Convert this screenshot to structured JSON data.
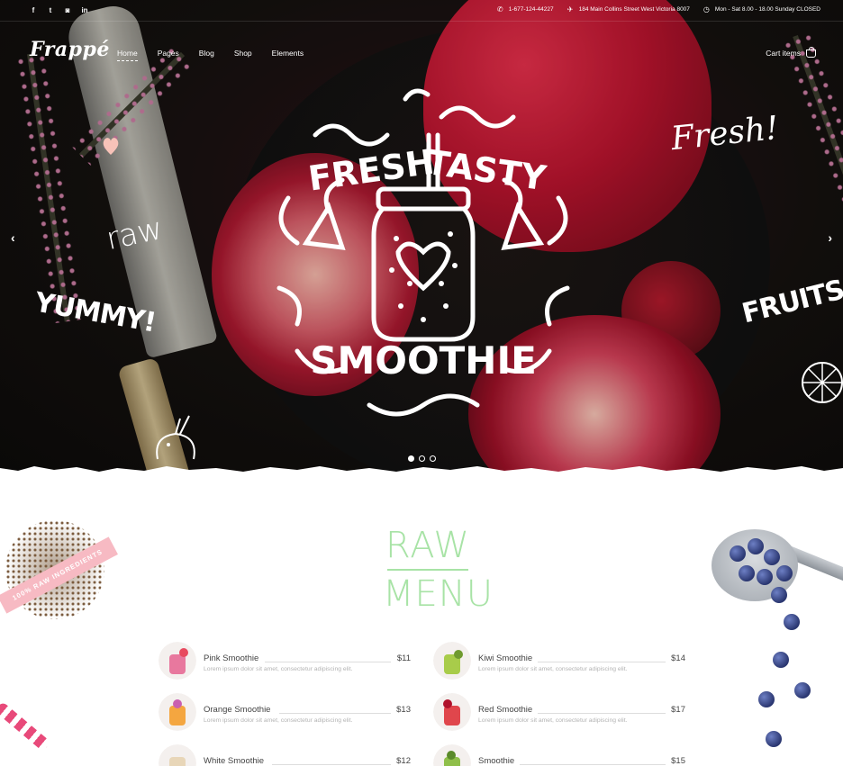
{
  "social": {
    "items": [
      {
        "icon": "facebook-icon",
        "glyph": "f"
      },
      {
        "icon": "twitter-icon",
        "glyph": "t"
      },
      {
        "icon": "instagram-icon",
        "glyph": "◙"
      },
      {
        "icon": "linkedin-icon",
        "glyph": "in"
      }
    ]
  },
  "contact": {
    "phone": "1-677-124-44227",
    "address": "184 Main Collins Street West Victoria 8007",
    "hours": "Mon - Sat 8.00 - 18.00 Sunday CLOSED"
  },
  "brand": {
    "logo": "Frappé"
  },
  "nav": {
    "items": [
      {
        "label": "Home",
        "active": true
      },
      {
        "label": "Pages",
        "active": false
      },
      {
        "label": "Blog",
        "active": false
      },
      {
        "label": "Shop",
        "active": false
      },
      {
        "label": "Elements",
        "active": false
      }
    ],
    "cart_label": "Cart items"
  },
  "hero": {
    "badge": {
      "line1_left": "FRESH",
      "line1_right": "TASTY",
      "line2": "SMOOTHIE"
    },
    "words": {
      "raw": "raw",
      "yummy": "YUMMY!",
      "fresh": "Fresh!",
      "fruits": "FRUITS"
    },
    "arrow_left": "‹",
    "arrow_right": "›",
    "slides": {
      "count": 3,
      "active": 1
    }
  },
  "ribbon": {
    "text": "100% RAW INGREDIENTS"
  },
  "menu": {
    "title_line1": "RAW",
    "title_line2": "MENU",
    "items": [
      {
        "name": "Pink Smoothie",
        "price": "$11",
        "desc": "Lorem ipsum dolor sit amet, consectetur adipiscing elit.",
        "color": "#e8789e"
      },
      {
        "name": "Kiwi Smoothie",
        "price": "$14",
        "desc": "Lorem ipsum dolor sit amet, consectetur adipiscing elit.",
        "color": "#a8cc4a"
      },
      {
        "name": "Orange Smoothie",
        "price": "$13",
        "desc": "Lorem ipsum dolor sit amet, consectetur adipiscing elit.",
        "color": "#f4a640"
      },
      {
        "name": "Red Smoothie",
        "price": "$17",
        "desc": "Lorem ipsum dolor sit amet, consectetur adipiscing elit.",
        "color": "#e0464c"
      },
      {
        "name": "White Smoothie",
        "price": "$12",
        "desc": "",
        "color": "#e8d6b8"
      },
      {
        "name": "Smoothie",
        "price": "$15",
        "desc": "",
        "color": "#8fbf4a"
      }
    ]
  }
}
